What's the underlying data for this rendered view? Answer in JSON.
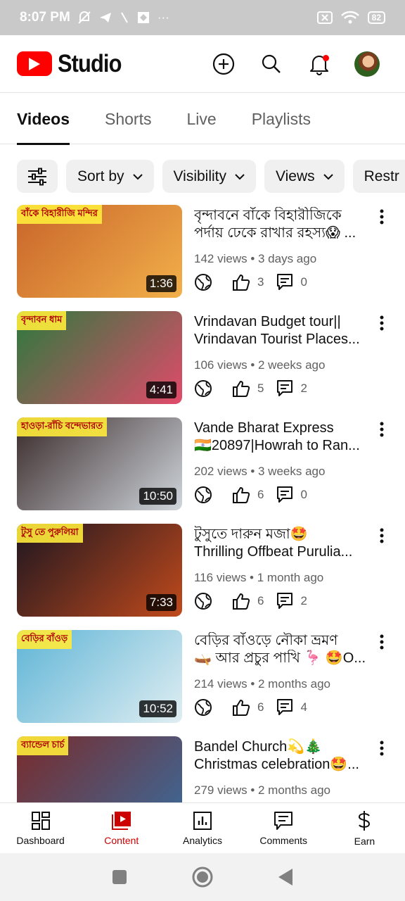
{
  "status_bar": {
    "time": "8:07 PM",
    "battery": "82",
    "left_icons": [
      "mute-icon",
      "telegram-icon",
      "missed-call-icon",
      "app-icon",
      "more-dots-icon"
    ],
    "right_icons": [
      "sim-off-icon",
      "wifi-icon",
      "battery-icon"
    ]
  },
  "header": {
    "brand": "Studio",
    "actions": [
      "create-icon",
      "search-icon",
      "notifications-icon",
      "avatar"
    ]
  },
  "tabs": [
    {
      "label": "Videos",
      "active": true
    },
    {
      "label": "Shorts",
      "active": false
    },
    {
      "label": "Live",
      "active": false
    },
    {
      "label": "Playlists",
      "active": false
    }
  ],
  "filters": {
    "icon": "filter-sliders-icon",
    "chips": [
      "Sort by",
      "Visibility",
      "Views",
      "Restr"
    ]
  },
  "videos": [
    {
      "title_line1": "বৃন্দাবনে বাঁকে বিহারীজিকে",
      "title_line2": "পর্দায় ঢেকে রাখার রহস্য😱 ...",
      "meta": "142 views • 3 days ago",
      "likes": "3",
      "comments": "0",
      "duration": "1:36",
      "thumb_caption": "বাঁকে বিহারীজি মন্দির",
      "thumb_colors": [
        "#c8642a",
        "#f2b04a"
      ]
    },
    {
      "title_line1": "Vrindavan Budget tour||",
      "title_line2": "Vrindavan Tourist Places...",
      "meta": "106 views • 2 weeks ago",
      "likes": "5",
      "comments": "2",
      "duration": "4:41",
      "thumb_caption": "বৃন্দাবন ধাম",
      "thumb_colors": [
        "#2b7a3e",
        "#e24a6a"
      ]
    },
    {
      "title_line1": "Vande Bharat Express",
      "title_line2": "🇮🇳20897|Howrah to Ran...",
      "meta": "202 views • 3 weeks ago",
      "likes": "6",
      "comments": "0",
      "duration": "10:50",
      "thumb_caption": "হাওড়া-রাঁচি বন্দেভারত",
      "thumb_colors": [
        "#3a2a2a",
        "#cfd6dc"
      ]
    },
    {
      "title_line1": "টুসুতে দারুন মজা🤩",
      "title_line2": "Thrilling Offbeat Purulia...",
      "meta": "116 views • 1 month ago",
      "likes": "6",
      "comments": "2",
      "duration": "7:33",
      "thumb_caption": "টুসু তে পুরুলিয়া",
      "thumb_colors": [
        "#1e1620",
        "#c04a1c"
      ]
    },
    {
      "title_line1": "বেড়ির বাঁওড়ে নৌকা ভ্রমণ",
      "title_line2": "🛶 আর প্রচুর পাখি 🦩 🤩O...",
      "meta": "214 views • 2 months ago",
      "likes": "6",
      "comments": "4",
      "duration": "10:52",
      "thumb_caption": "বেড়ির বাঁওড়",
      "thumb_colors": [
        "#5fb5d6",
        "#e0eef2"
      ]
    },
    {
      "title_line1": "Bandel Church💫🎄",
      "title_line2": "Christmas celebration🤩...",
      "meta": "279 views • 2 months ago",
      "likes": "",
      "comments": "",
      "duration": "",
      "thumb_caption": "ব্যান্ডেল চার্চ",
      "thumb_colors": [
        "#7a2a2a",
        "#3b6a9a"
      ]
    }
  ],
  "bottom_nav": [
    {
      "label": "Dashboard",
      "icon": "dashboard-icon",
      "active": false
    },
    {
      "label": "Content",
      "icon": "content-icon",
      "active": true
    },
    {
      "label": "Analytics",
      "icon": "analytics-icon",
      "active": false
    },
    {
      "label": "Comments",
      "icon": "comments-icon",
      "active": false
    },
    {
      "label": "Earn",
      "icon": "earn-dollar-icon",
      "active": false
    }
  ],
  "system_nav": [
    "recents-icon",
    "home-icon",
    "back-icon"
  ],
  "colors": {
    "brand_red": "#ff0000",
    "active_nav": "#cc0000",
    "secondary_text": "#606060",
    "chip_bg": "#f0f0f0"
  }
}
